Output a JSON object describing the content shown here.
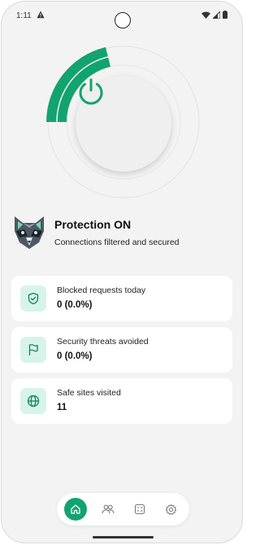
{
  "status_bar": {
    "time": "1:11"
  },
  "protection": {
    "title": "Protection ON",
    "subtitle": "Connections filtered and secured"
  },
  "stats": [
    {
      "label": "Blocked requests today",
      "value": "0 (0.0%)",
      "icon": "shield-icon"
    },
    {
      "label": "Security threats avoided",
      "value": "0 (0.0%)",
      "icon": "flag-icon"
    },
    {
      "label": "Safe sites visited",
      "value": "11",
      "icon": "globe-icon"
    }
  ],
  "nav": {
    "items": [
      "home-icon",
      "users-icon",
      "checklist-icon",
      "gear-icon"
    ],
    "active": "home-icon"
  },
  "colors": {
    "accent": "#12a370",
    "icon_bg": "#d7f4ea",
    "background": "#f3f3f3"
  }
}
